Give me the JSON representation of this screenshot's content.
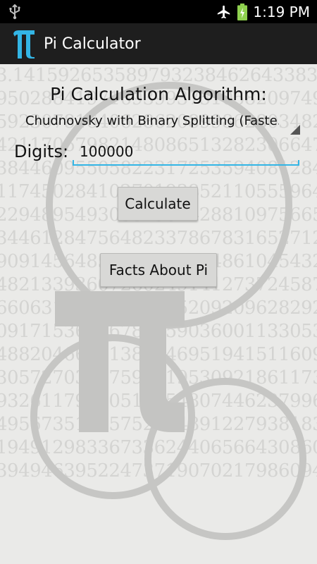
{
  "status_bar": {
    "time": "1:19 PM",
    "icons": [
      "usb-icon",
      "airplane-mode-icon",
      "battery-charging-icon"
    ]
  },
  "action_bar": {
    "logo_icon": "pi-symbol-icon",
    "title": "Pi Calculator"
  },
  "form": {
    "algorithm_label": "Pi Calculation Algorithm:",
    "algorithm_selected": "Chudnovsky with Binary Splitting (Faste...",
    "digits_label": "Digits:",
    "digits_value": "100000",
    "calculate_label": "Calculate",
    "facts_label": "Facts About Pi"
  },
  "background": {
    "digit_rows": [
      "3.14159265358979323846264338327",
      "9502884197169399375105820974944",
      "5923078164062862089986280348253",
      "4211706798214808651328230664709",
      "3844609550582231725359408128481",
      "1174502841027019385211055596446",
      "2294895493038196442881097566593",
      "3446128475648233786783165271201",
      "9091456485669234603486104543266",
      "4821339360726024914127372458700",
      "6606315588174881520920962829254",
      "0917153643678925903600113305305",
      "4882046652138414695194151160943",
      "3057270365759591953092186117381",
      "9326117931051185480744623799627",
      "4956735188575272489122793818301",
      "1949129833673362440656643086021",
      "3949463952247371907021798609437"
    ],
    "colors": {
      "background": "#eaeae8",
      "digits": "#d4d4d2",
      "artwork": "#c6c6c4",
      "accent": "#33b5e5"
    }
  }
}
